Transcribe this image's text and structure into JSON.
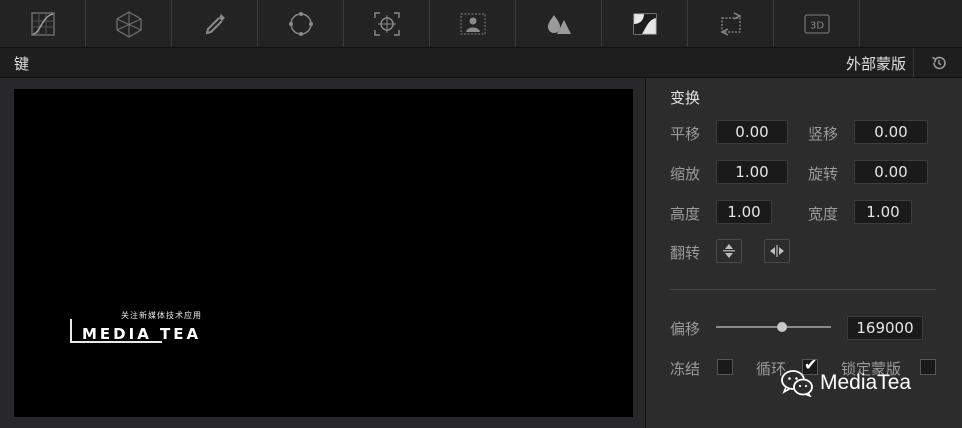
{
  "toolbar": {
    "tools": [
      {
        "icon": "curve-icon"
      },
      {
        "icon": "warper-icon"
      },
      {
        "icon": "eyedropper-icon"
      },
      {
        "icon": "power-window-icon"
      },
      {
        "icon": "tracker-icon"
      },
      {
        "icon": "magic-mask-icon"
      },
      {
        "icon": "blur-icon"
      },
      {
        "icon": "key-icon",
        "active": true
      },
      {
        "icon": "sizing-icon"
      },
      {
        "icon": "3d-icon",
        "label": "3D"
      }
    ]
  },
  "header": {
    "title": "键",
    "mask_label": "外部蒙版",
    "reset_icon": "reset-icon"
  },
  "viewer": {
    "watermark_sub": "关注新媒体技术应用",
    "watermark_main": "MEDIA TEA"
  },
  "transform": {
    "title": "变换",
    "pan_label": "平移",
    "pan_value": "0.00",
    "tilt_label": "竖移",
    "tilt_value": "0.00",
    "zoom_label": "缩放",
    "zoom_value": "1.00",
    "rotate_label": "旋转",
    "rotate_value": "0.00",
    "height_label": "高度",
    "height_value": "1.00",
    "width_label": "宽度",
    "width_value": "1.00",
    "flip_label": "翻转"
  },
  "offset": {
    "label": "偏移",
    "value": "169000",
    "slider_fraction": 0.57
  },
  "options": {
    "freeze_label": "冻结",
    "freeze_checked": false,
    "loop_label": "循环",
    "loop_checked": true,
    "lock_mask_label": "锁定蒙版",
    "lock_mask_checked": false
  },
  "overlay": {
    "brand": "MediaTea"
  },
  "colors": {
    "background": "#282829",
    "panel": "#2c2c2d",
    "field_bg": "#1a1a1b",
    "accent_white": "#ffffff"
  }
}
